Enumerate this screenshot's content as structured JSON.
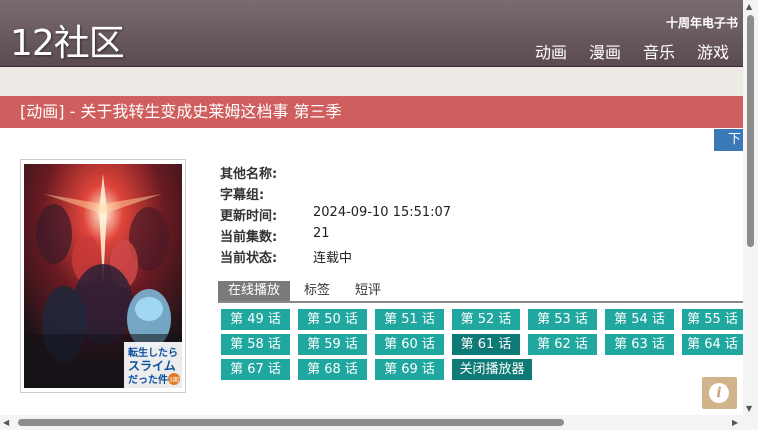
{
  "site": {
    "logo": "12社区",
    "top_link": "十周年电子书",
    "nav": [
      "动画",
      "漫画",
      "音乐",
      "游戏"
    ]
  },
  "page": {
    "title": "[动画] - 关于我转生变成史莱姆这档事 第三季",
    "download_button": "下",
    "poster_text": [
      "転生したら",
      "スライム",
      "だった件"
    ],
    "poster_badge": "3期"
  },
  "info": [
    {
      "label": "其他名称:",
      "value": ""
    },
    {
      "label": "字幕组:",
      "value": ""
    },
    {
      "label": "更新时间:",
      "value": "2024-09-10 15:51:07"
    },
    {
      "label": "当前集数:",
      "value": "21"
    },
    {
      "label": "当前状态:",
      "value": "连载中"
    }
  ],
  "tabs": [
    "在线播放",
    "标签",
    "短评"
  ],
  "episodes": [
    [
      "第 49 话",
      "第 50 话",
      "第 51 话",
      "第 52 话",
      "第 53 话",
      "第 54 话",
      "第 55 话"
    ],
    [
      "第 58 话",
      "第 59 话",
      "第 60 话",
      "第 61 话",
      "第 62 话",
      "第 63 话",
      "第 64 话"
    ],
    [
      "第 67 话",
      "第 68 话",
      "第 69 话",
      "关闭播放器"
    ]
  ],
  "info_float_icon": "i",
  "colors": {
    "header": "#6a5a62",
    "title_bar": "#cf5e5e",
    "episode_button": "#20a8a0",
    "episode_button_dark": "#0e7a76",
    "download_button": "#3a78b8"
  }
}
